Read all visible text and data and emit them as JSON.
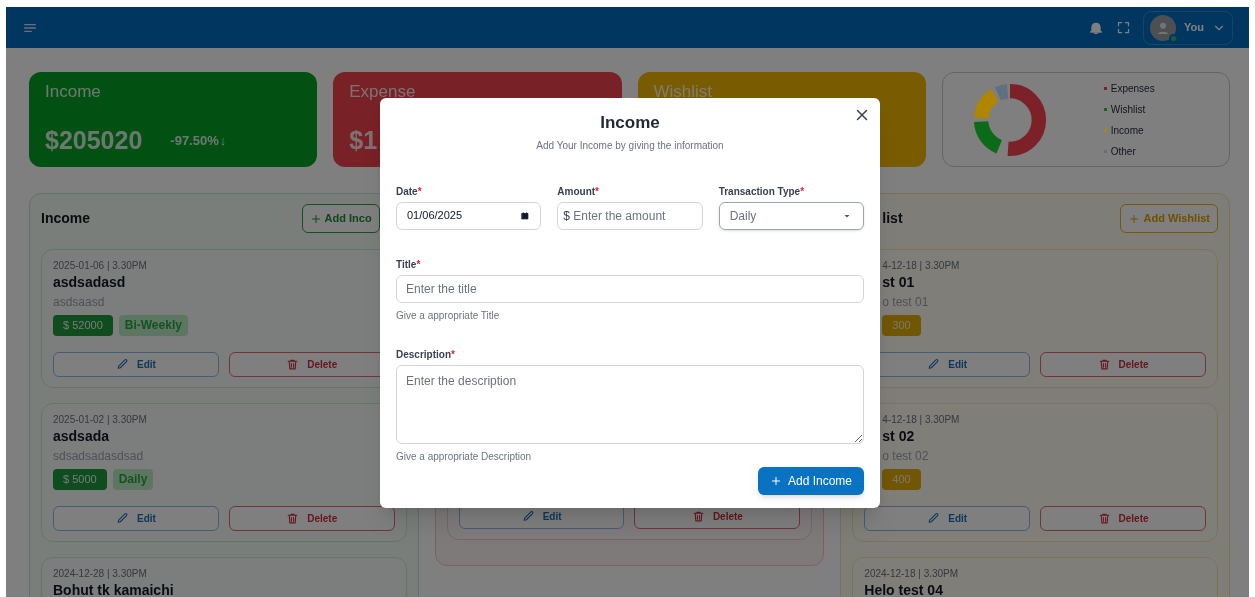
{
  "header": {
    "user": {
      "name": "You",
      "online": true
    }
  },
  "stat_cards": [
    {
      "kind": "income",
      "label": "Income",
      "amount": "$205020",
      "change": "-97.50%",
      "trend_arrow": "↓"
    },
    {
      "kind": "expense",
      "label": "Expense",
      "amount": "$1"
    },
    {
      "kind": "wishlist",
      "label": "Wishlist"
    }
  ],
  "summary": {
    "legend": [
      {
        "label": "Expenses",
        "color": "#7d2129"
      },
      {
        "label": "Wishlist",
        "color": "#0b6b18"
      },
      {
        "label": "Income",
        "color": "#b08600"
      },
      {
        "label": "Other",
        "color": "#607080"
      }
    ]
  },
  "columns": [
    {
      "kind": "income",
      "title": "Income",
      "add_button": "Add Inco",
      "items": [
        {
          "date": "2025-01-06 | 3.30PM",
          "title": "asdsadasd",
          "description": "asdsaasd",
          "amount": "$ 52000",
          "frequency": "Bi-Weekly",
          "edit": "Edit",
          "delete": "Delete"
        },
        {
          "date": "2025-01-02 | 3.30PM",
          "title": "asdsada",
          "description": "sdsadsadasdsad",
          "amount": "$ 5000",
          "frequency": "Daily",
          "edit": "Edit",
          "delete": "Delete"
        },
        {
          "date": "2024-12-28 | 3.30PM",
          "title": "Bohut tk kamaichi"
        }
      ]
    },
    {
      "kind": "expense",
      "items": [
        {
          "edit": "Edit",
          "delete": "Delete"
        }
      ]
    },
    {
      "kind": "wishlist",
      "title": "list",
      "add_button": "Add Wishlist",
      "items": [
        {
          "date": "4-12-18 | 3.30PM",
          "title": "st 01",
          "description": "o test 01",
          "amount": "300",
          "edit": "Edit",
          "delete": "Delete"
        },
        {
          "date": "4-12-18 | 3.30PM",
          "title": "st 02",
          "description": "o test 02",
          "amount": "400",
          "edit": "Edit",
          "delete": "Delete"
        },
        {
          "date": "2024-12-18 | 3.30PM",
          "title": "Helo test 04"
        }
      ]
    }
  ],
  "modal": {
    "title": "Income",
    "subtitle": "Add Your Income by giving the information",
    "fields": [
      {
        "kind": "date",
        "label": "Date",
        "required_mark": "*",
        "value": "01/06/2025"
      },
      {
        "kind": "amount",
        "label": "Amount",
        "required_mark": "*",
        "prefix": "$",
        "placeholder": "Enter the amount"
      },
      {
        "kind": "select",
        "label": "Transaction Type",
        "required_mark": "*",
        "value": "Daily"
      },
      {
        "kind": "text",
        "label": "Title",
        "required_mark": "*",
        "placeholder": "Enter the title",
        "hint": "Give a appropriate Title"
      },
      {
        "kind": "textarea",
        "label": "Description",
        "required_mark": "*",
        "placeholder": "Enter the description",
        "hint": "Give a appropriate Description"
      }
    ],
    "submit": "Add Income"
  }
}
